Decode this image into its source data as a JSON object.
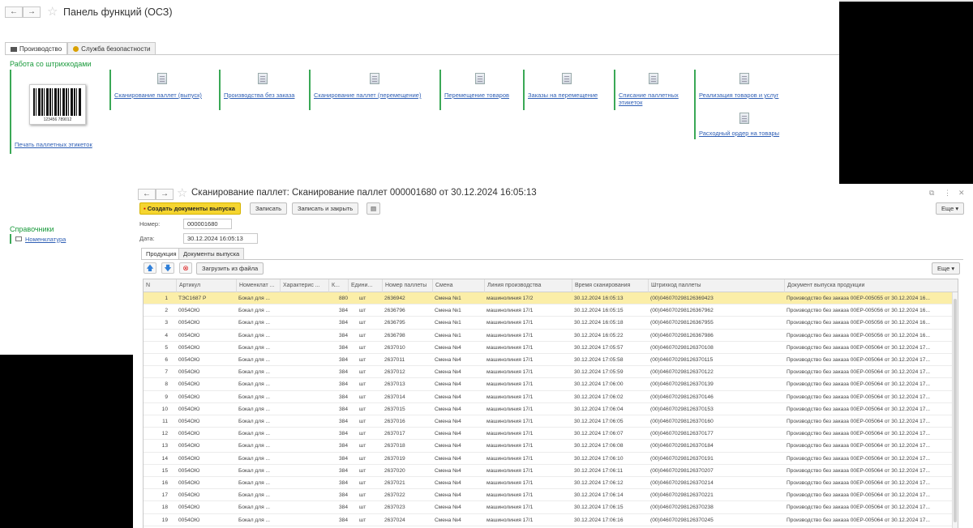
{
  "back": {
    "title": "Панель функций (ОСЗ)",
    "tabs": [
      {
        "label": "Производство",
        "icon": "factory-icon"
      },
      {
        "label": "Служба безопастности",
        "icon": "security-icon"
      }
    ],
    "barcode_group": {
      "title": "Работа со штрихкодами",
      "print_link": "Печать паллетных этикеток",
      "barcode_digits": "123456 789012"
    },
    "links": [
      "Сканирование паллет (выпуск)",
      "Производства без заказа",
      "Сканирование паллет (перемещение)",
      "Перемещение товаров",
      "Заказы на перемещение",
      "Списание паллетных",
      "этикеток",
      "Реализация товаров и услуг",
      "Расходный ордер на товары"
    ],
    "refs": {
      "title": "Справочники",
      "item": "Номенклатура"
    }
  },
  "front": {
    "title": "Сканирование паллет: Сканирование паллет 000001680 от 30.12.2024 16:05:13",
    "toolbar": {
      "create_docs": "Создать документы выпуска",
      "save": "Записать",
      "save_close": "Записать и закрыть",
      "more": "Еще",
      "more_arrow": "▾"
    },
    "fields": {
      "number_label": "Номер:",
      "number_value": "000001680",
      "date_label": "Дата:",
      "date_value": "30.12.2024 16:05:13"
    },
    "tabs": [
      "Продукция",
      "Документы выпуска"
    ],
    "table_toolbar": {
      "load_from_file": "Загрузить из файла",
      "more": "Еще"
    },
    "columns": [
      "N",
      "Артикул",
      "Номенклат ...",
      "Характерис ...",
      "К...",
      "Едини...",
      "Номер паллеты",
      "Смена",
      "Линия производства",
      "Время сканирования",
      "Штрихкод паллеты",
      "Документ выпуска продукции"
    ],
    "rows": [
      {
        "n": "1",
        "art": "ТЭС1687 Р",
        "nom": "Бокал для ...",
        "qty": "880",
        "unit": "шт",
        "pallet": "2636942",
        "shift": "Смена №1",
        "line": "машинолиния 17/2",
        "time": "30.12.2024 16:05:13",
        "barcode": "(00)046070298126369423",
        "doc": "Производство без заказа 00ЕР-005055 от 30.12.2024 16..."
      },
      {
        "n": "2",
        "art": "0054ОЮ",
        "nom": "Бокал для ...",
        "qty": "384",
        "unit": "шт",
        "pallet": "2636796",
        "shift": "Смена №1",
        "line": "машинолиния 17/1",
        "time": "30.12.2024 16:05:15",
        "barcode": "(00)046070298126367962",
        "doc": "Производство без заказа 00ЕР-005056 от 30.12.2024 16..."
      },
      {
        "n": "3",
        "art": "0054ОЮ",
        "nom": "Бокал для ...",
        "qty": "384",
        "unit": "шт",
        "pallet": "2636795",
        "shift": "Смена №1",
        "line": "машинолиния 17/1",
        "time": "30.12.2024 16:05:18",
        "barcode": "(00)046070298126367955",
        "doc": "Производство без заказа 00ЕР-005056 от 30.12.2024 16..."
      },
      {
        "n": "4",
        "art": "0054ОЮ",
        "nom": "Бокал для ...",
        "qty": "384",
        "unit": "шт",
        "pallet": "2636798",
        "shift": "Смена №1",
        "line": "машинолиния 17/1",
        "time": "30.12.2024 16:05:22",
        "barcode": "(00)046070298126367986",
        "doc": "Производство без заказа 00ЕР-005056 от 30.12.2024 16..."
      },
      {
        "n": "5",
        "art": "0054ОЮ",
        "nom": "Бокал для ...",
        "qty": "384",
        "unit": "шт",
        "pallet": "2637010",
        "shift": "Смена №4",
        "line": "машинолиния 17/1",
        "time": "30.12.2024 17:05:57",
        "barcode": "(00)046070298126370108",
        "doc": "Производство без заказа 00ЕР-005064 от 30.12.2024 17..."
      },
      {
        "n": "6",
        "art": "0054ОЮ",
        "nom": "Бокал для ...",
        "qty": "384",
        "unit": "шт",
        "pallet": "2637011",
        "shift": "Смена №4",
        "line": "машинолиния 17/1",
        "time": "30.12.2024 17:05:58",
        "barcode": "(00)046070298126370115",
        "doc": "Производство без заказа 00ЕР-005064 от 30.12.2024 17..."
      },
      {
        "n": "7",
        "art": "0054ОЮ",
        "nom": "Бокал для ...",
        "qty": "384",
        "unit": "шт",
        "pallet": "2637012",
        "shift": "Смена №4",
        "line": "машинолиния 17/1",
        "time": "30.12.2024 17:05:59",
        "barcode": "(00)046070298126370122",
        "doc": "Производство без заказа 00ЕР-005064 от 30.12.2024 17..."
      },
      {
        "n": "8",
        "art": "0054ОЮ",
        "nom": "Бокал для ...",
        "qty": "384",
        "unit": "шт",
        "pallet": "2637013",
        "shift": "Смена №4",
        "line": "машинолиния 17/1",
        "time": "30.12.2024 17:06:00",
        "barcode": "(00)046070298126370139",
        "doc": "Производство без заказа 00ЕР-005064 от 30.12.2024 17..."
      },
      {
        "n": "9",
        "art": "0054ОЮ",
        "nom": "Бокал для ...",
        "qty": "384",
        "unit": "шт",
        "pallet": "2637014",
        "shift": "Смена №4",
        "line": "машинолиния 17/1",
        "time": "30.12.2024 17:06:02",
        "barcode": "(00)046070298126370146",
        "doc": "Производство без заказа 00ЕР-005064 от 30.12.2024 17..."
      },
      {
        "n": "10",
        "art": "0054ОЮ",
        "nom": "Бокал для ...",
        "qty": "384",
        "unit": "шт",
        "pallet": "2637015",
        "shift": "Смена №4",
        "line": "машинолиния 17/1",
        "time": "30.12.2024 17:06:04",
        "barcode": "(00)046070298126370153",
        "doc": "Производство без заказа 00ЕР-005064 от 30.12.2024 17..."
      },
      {
        "n": "11",
        "art": "0054ОЮ",
        "nom": "Бокал для ...",
        "qty": "384",
        "unit": "шт",
        "pallet": "2637016",
        "shift": "Смена №4",
        "line": "машинолиния 17/1",
        "time": "30.12.2024 17:06:05",
        "barcode": "(00)046070298126370160",
        "doc": "Производство без заказа 00ЕР-005064 от 30.12.2024 17..."
      },
      {
        "n": "12",
        "art": "0054ОЮ",
        "nom": "Бокал для ...",
        "qty": "384",
        "unit": "шт",
        "pallet": "2637017",
        "shift": "Смена №4",
        "line": "машинолиния 17/1",
        "time": "30.12.2024 17:06:07",
        "barcode": "(00)046070298126370177",
        "doc": "Производство без заказа 00ЕР-005064 от 30.12.2024 17..."
      },
      {
        "n": "13",
        "art": "0054ОЮ",
        "nom": "Бокал для ...",
        "qty": "384",
        "unit": "шт",
        "pallet": "2637018",
        "shift": "Смена №4",
        "line": "машинолиния 17/1",
        "time": "30.12.2024 17:06:08",
        "barcode": "(00)046070298126370184",
        "doc": "Производство без заказа 00ЕР-005064 от 30.12.2024 17..."
      },
      {
        "n": "14",
        "art": "0054ОЮ",
        "nom": "Бокал для ...",
        "qty": "384",
        "unit": "шт",
        "pallet": "2637019",
        "shift": "Смена №4",
        "line": "машинолиния 17/1",
        "time": "30.12.2024 17:06:10",
        "barcode": "(00)046070298126370191",
        "doc": "Производство без заказа 00ЕР-005064 от 30.12.2024 17..."
      },
      {
        "n": "15",
        "art": "0054ОЮ",
        "nom": "Бокал для ...",
        "qty": "384",
        "unit": "шт",
        "pallet": "2637020",
        "shift": "Смена №4",
        "line": "машинолиния 17/1",
        "time": "30.12.2024 17:06:11",
        "barcode": "(00)046070298126370207",
        "doc": "Производство без заказа 00ЕР-005064 от 30.12.2024 17..."
      },
      {
        "n": "16",
        "art": "0054ОЮ",
        "nom": "Бокал для ...",
        "qty": "384",
        "unit": "шт",
        "pallet": "2637021",
        "shift": "Смена №4",
        "line": "машинолиния 17/1",
        "time": "30.12.2024 17:06:12",
        "barcode": "(00)046070298126370214",
        "doc": "Производство без заказа 00ЕР-005064 от 30.12.2024 17..."
      },
      {
        "n": "17",
        "art": "0054ОЮ",
        "nom": "Бокал для ...",
        "qty": "384",
        "unit": "шт",
        "pallet": "2637022",
        "shift": "Смена №4",
        "line": "машинолиния 17/1",
        "time": "30.12.2024 17:06:14",
        "barcode": "(00)046070298126370221",
        "doc": "Производство без заказа 00ЕР-005064 от 30.12.2024 17..."
      },
      {
        "n": "18",
        "art": "0054ОЮ",
        "nom": "Бокал для ...",
        "qty": "384",
        "unit": "шт",
        "pallet": "2637023",
        "shift": "Смена №4",
        "line": "машинолиния 17/1",
        "time": "30.12.2024 17:06:15",
        "barcode": "(00)046070298126370238",
        "doc": "Производство без заказа 00ЕР-005064 от 30.12.2024 17..."
      },
      {
        "n": "19",
        "art": "0054ОЮ",
        "nom": "Бокал для ...",
        "qty": "384",
        "unit": "шт",
        "pallet": "2637024",
        "shift": "Смена №4",
        "line": "машинолиния 17/1",
        "time": "30.12.2024 17:06:16",
        "barcode": "(00)046070298126370245",
        "doc": "Производство без заказа 00ЕР-005064 от 30.12.2024 17..."
      }
    ]
  },
  "colors": {
    "accent_green": "#1a9a3c",
    "link_blue": "#2f5fb5",
    "selected_row": "#fbeea8",
    "primary_button": "#f5d530"
  }
}
